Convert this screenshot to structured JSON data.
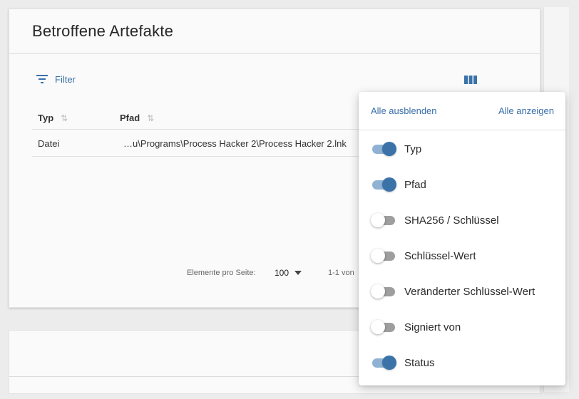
{
  "card": {
    "title": "Betroffene Artefakte",
    "filter_label": "Filter",
    "columns_icon": "view-column-icon"
  },
  "table": {
    "headers": [
      "Typ",
      "Pfad"
    ],
    "rows": [
      {
        "typ": "Datei",
        "pfad": "…u\\Programs\\Process Hacker 2\\Process Hacker 2.lnk"
      }
    ]
  },
  "pagination": {
    "items_per_page_label": "Elemente pro Seite:",
    "items_per_page_value": "100",
    "range_label": "1-1 von"
  },
  "column_menu": {
    "hide_all": "Alle ausblenden",
    "show_all": "Alle anzeigen",
    "columns": [
      {
        "label": "Typ",
        "enabled": true
      },
      {
        "label": "Pfad",
        "enabled": true
      },
      {
        "label": "SHA256 / Schlüssel",
        "enabled": false
      },
      {
        "label": "Schlüssel-Wert",
        "enabled": false
      },
      {
        "label": "Veränderter Schlüssel-Wert",
        "enabled": false
      },
      {
        "label": "Signiert von",
        "enabled": false
      },
      {
        "label": "Status",
        "enabled": true
      }
    ]
  },
  "colors": {
    "accent": "#3b73a8",
    "accent_light": "#8fb2d4",
    "link": "#3a6fa8"
  }
}
